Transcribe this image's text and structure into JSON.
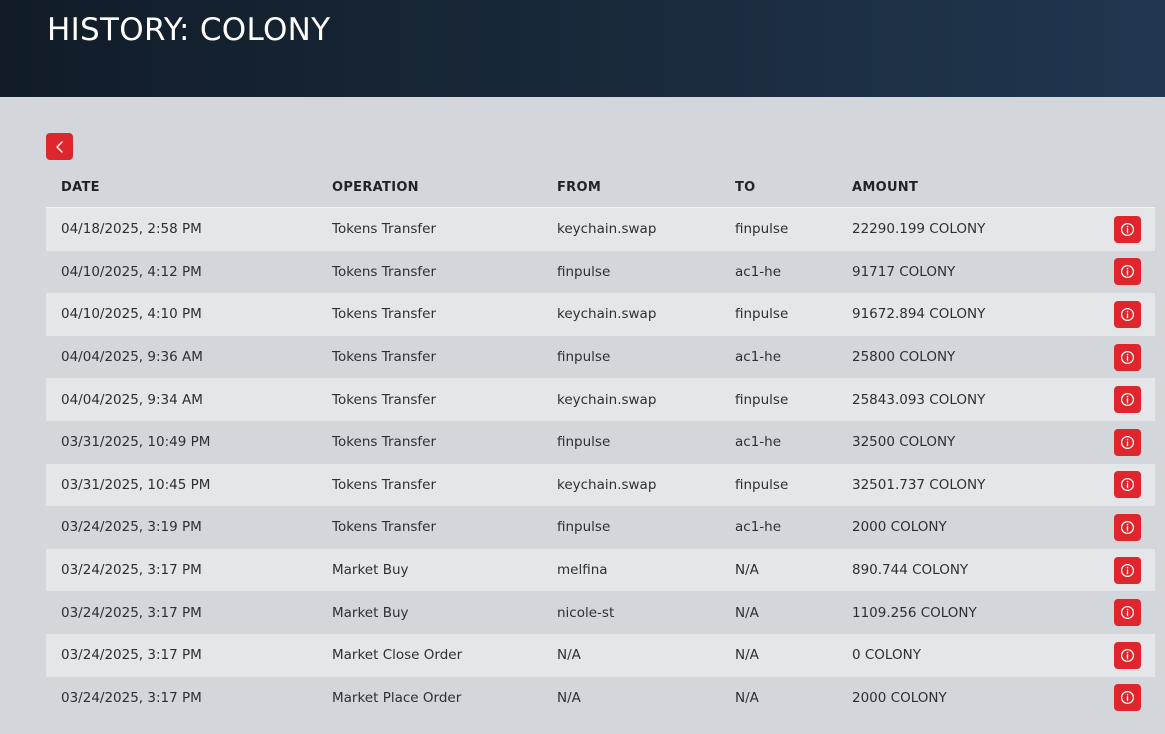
{
  "header": {
    "title": "HISTORY: COLONY"
  },
  "table": {
    "columns": [
      "DATE",
      "OPERATION",
      "FROM",
      "TO",
      "AMOUNT"
    ],
    "rows": [
      {
        "date": "04/18/2025, 2:58 PM",
        "operation": "Tokens Transfer",
        "from": "keychain.swap",
        "to": "finpulse",
        "amount": "22290.199 COLONY"
      },
      {
        "date": "04/10/2025, 4:12 PM",
        "operation": "Tokens Transfer",
        "from": "finpulse",
        "to": "ac1-he",
        "amount": "91717 COLONY"
      },
      {
        "date": "04/10/2025, 4:10 PM",
        "operation": "Tokens Transfer",
        "from": "keychain.swap",
        "to": "finpulse",
        "amount": "91672.894 COLONY"
      },
      {
        "date": "04/04/2025, 9:36 AM",
        "operation": "Tokens Transfer",
        "from": "finpulse",
        "to": "ac1-he",
        "amount": "25800 COLONY"
      },
      {
        "date": "04/04/2025, 9:34 AM",
        "operation": "Tokens Transfer",
        "from": "keychain.swap",
        "to": "finpulse",
        "amount": "25843.093 COLONY"
      },
      {
        "date": "03/31/2025, 10:49 PM",
        "operation": "Tokens Transfer",
        "from": "finpulse",
        "to": "ac1-he",
        "amount": "32500 COLONY"
      },
      {
        "date": "03/31/2025, 10:45 PM",
        "operation": "Tokens Transfer",
        "from": "keychain.swap",
        "to": "finpulse",
        "amount": "32501.737 COLONY"
      },
      {
        "date": "03/24/2025, 3:19 PM",
        "operation": "Tokens Transfer",
        "from": "finpulse",
        "to": "ac1-he",
        "amount": "2000 COLONY"
      },
      {
        "date": "03/24/2025, 3:17 PM",
        "operation": "Market Buy",
        "from": "melfina",
        "to": "N/A",
        "amount": "890.744 COLONY"
      },
      {
        "date": "03/24/2025, 3:17 PM",
        "operation": "Market Buy",
        "from": "nicole-st",
        "to": "N/A",
        "amount": "1109.256 COLONY"
      },
      {
        "date": "03/24/2025, 3:17 PM",
        "operation": "Market Close Order",
        "from": "N/A",
        "to": "N/A",
        "amount": "0 COLONY"
      },
      {
        "date": "03/24/2025, 3:17 PM",
        "operation": "Market Place Order",
        "from": "N/A",
        "to": "N/A",
        "amount": "2000 COLONY"
      }
    ]
  },
  "icons": {
    "back": "chevron-left-icon",
    "info": "info-circle-icon"
  },
  "colors": {
    "accent": "#e0262d",
    "header_bg": "#1a2a3c",
    "page_bg": "#d3d6db",
    "row_alt": "#e4e6ea"
  }
}
